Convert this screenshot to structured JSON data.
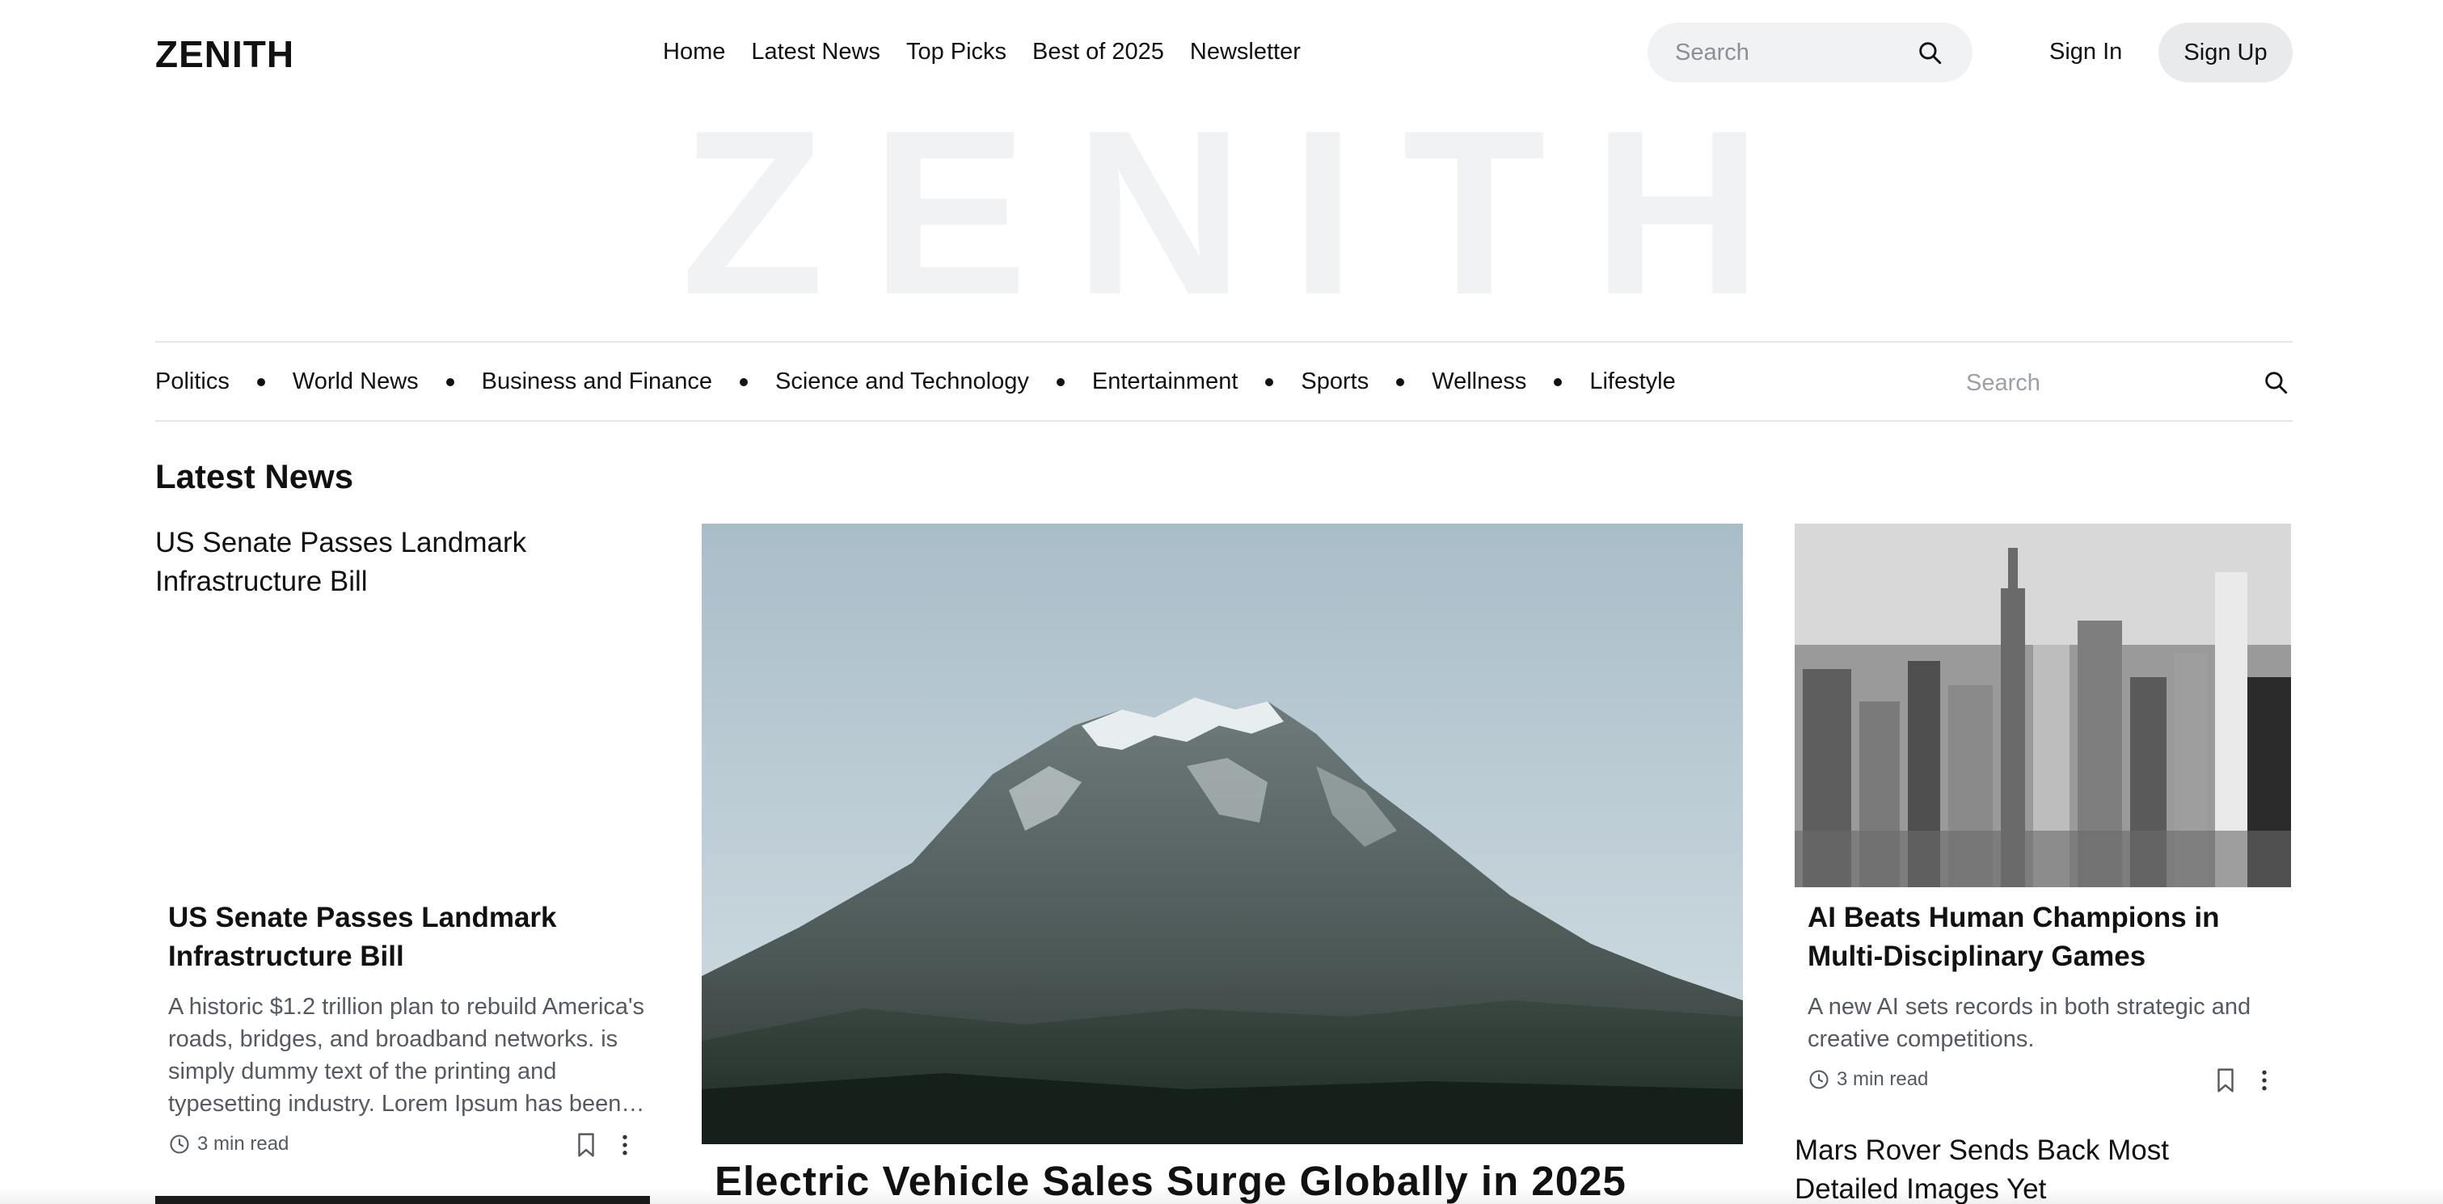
{
  "header": {
    "logo": "ZENITH",
    "nav": [
      "Home",
      "Latest News",
      "Top Picks",
      "Best of 2025",
      "Newsletter"
    ],
    "search_placeholder": "Search",
    "sign_in": "Sign In",
    "sign_up": "Sign Up"
  },
  "hero": {
    "watermark": "ZENITH"
  },
  "categories": {
    "items": [
      "Politics",
      "World News",
      "Business and Finance",
      "Science and Technology",
      "Entertainment",
      "Sports",
      "Wellness",
      "Lifestyle"
    ],
    "search_placeholder": "Search"
  },
  "latest": {
    "title": "Latest News",
    "left": {
      "headline": "US Senate Passes Landmark Infrastructure Bill",
      "card_title": "US Senate Passes Landmark Infrastructure Bill",
      "excerpt": "A historic $1.2 trillion plan to rebuild America's roads, bridges, and broadband networks. is simply dummy text of the printing and typesetting industry. Lorem Ipsum has been…",
      "read_time": "3 min read"
    },
    "main": {
      "title": "Electric Vehicle Sales Surge Globally in 2025",
      "image": "snowy-mountain-photo"
    },
    "right": {
      "image": "city-skyline-photo",
      "card_title": "AI Beats Human Champions in Multi-Disciplinary Games",
      "excerpt": "A new AI sets records in both strategic and creative competitions.",
      "read_time": "3 min read",
      "next_headline": "Mars Rover Sends Back Most Detailed Images Yet"
    }
  },
  "colors": {
    "text": "#111111",
    "muted": "#555a62",
    "pill_bg": "#f1f2f4",
    "signup_bg": "#e9eaec",
    "divider": "#e4e5e7"
  }
}
